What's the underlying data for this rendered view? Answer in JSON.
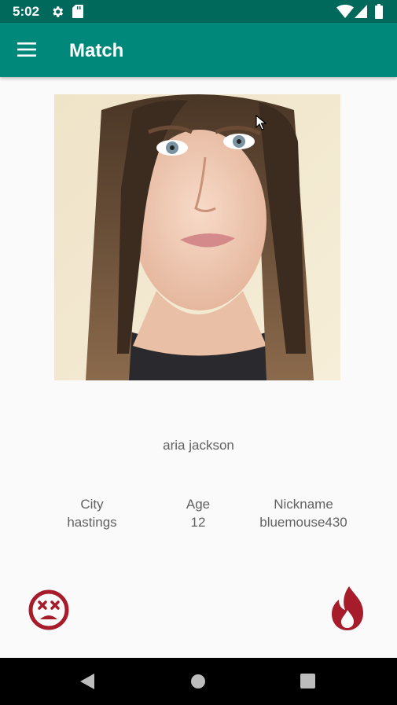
{
  "status_bar": {
    "time": "5:02",
    "icons": [
      "gear-icon",
      "sd-card-icon",
      "wifi-icon",
      "signal-icon",
      "battery-icon"
    ]
  },
  "app_bar": {
    "title": "Match",
    "menu_icon": "hamburger-menu-icon"
  },
  "profile": {
    "name": "aria jackson",
    "fields": [
      {
        "label": "City",
        "value": "hastings"
      },
      {
        "label": "Age",
        "value": "12"
      },
      {
        "label": "Nickname",
        "value": "bluemouse430"
      }
    ]
  },
  "actions": {
    "dislike_icon": "dead-face-icon",
    "like_icon": "flame-icon",
    "color": "#a61c2a"
  },
  "nav_bar": {
    "icons": [
      "back-triangle-icon",
      "home-circle-icon",
      "recents-square-icon"
    ]
  },
  "colors": {
    "status_bar": "#00695c",
    "app_bar": "#00897b"
  }
}
